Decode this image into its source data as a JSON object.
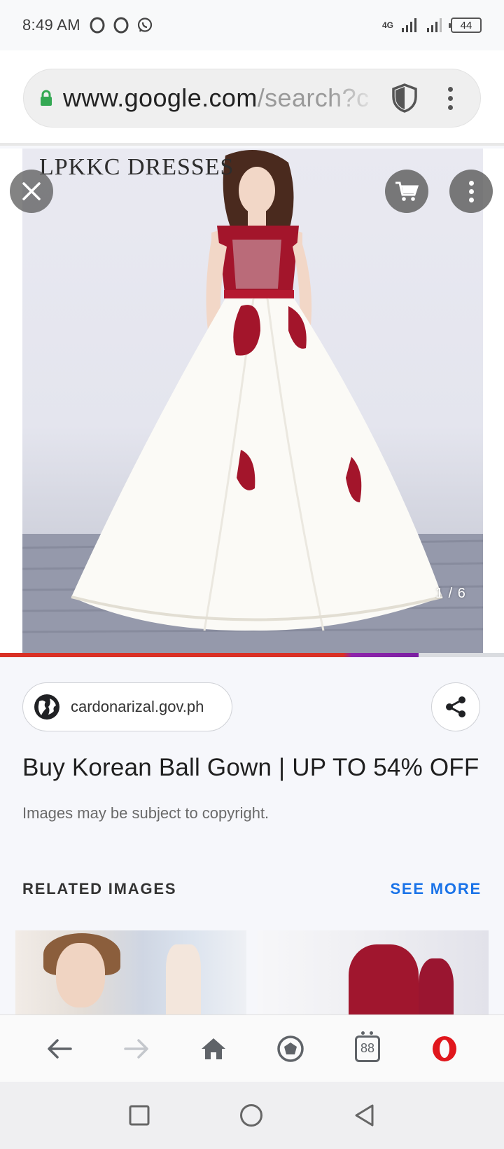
{
  "status": {
    "time": "8:49 AM",
    "network": "4G",
    "battery": "44"
  },
  "browser": {
    "url_host": "www.google.com",
    "url_path": "/search?c"
  },
  "viewer": {
    "brand_text": "LPKKC  DRESSES",
    "counter": "1 / 6",
    "progress": 0.83
  },
  "result": {
    "source": "cardonarizal.gov.ph",
    "title": "Buy Korean Ball Gown | UP TO 54% OFF",
    "copyright": "Images may be subject to copyright."
  },
  "related": {
    "heading": "RELATED IMAGES",
    "see_more": "SEE MORE"
  },
  "bottom_bar": {
    "tab_count": "88"
  },
  "colors": {
    "accent": "#1a73e8",
    "opera_red": "#e0161c",
    "progress": "#d93025"
  },
  "icons": [
    "opera-icon",
    "whatsapp-icon",
    "signal-icon",
    "lock-icon",
    "shield-icon",
    "more-vert-icon",
    "close-icon",
    "cart-icon",
    "globe-icon",
    "share-icon",
    "back-arrow-icon",
    "forward-arrow-icon",
    "home-icon",
    "speed-dial-icon",
    "tabs-icon",
    "opera-menu-icon",
    "recents-icon",
    "home-circle-icon",
    "back-triangle-icon"
  ]
}
